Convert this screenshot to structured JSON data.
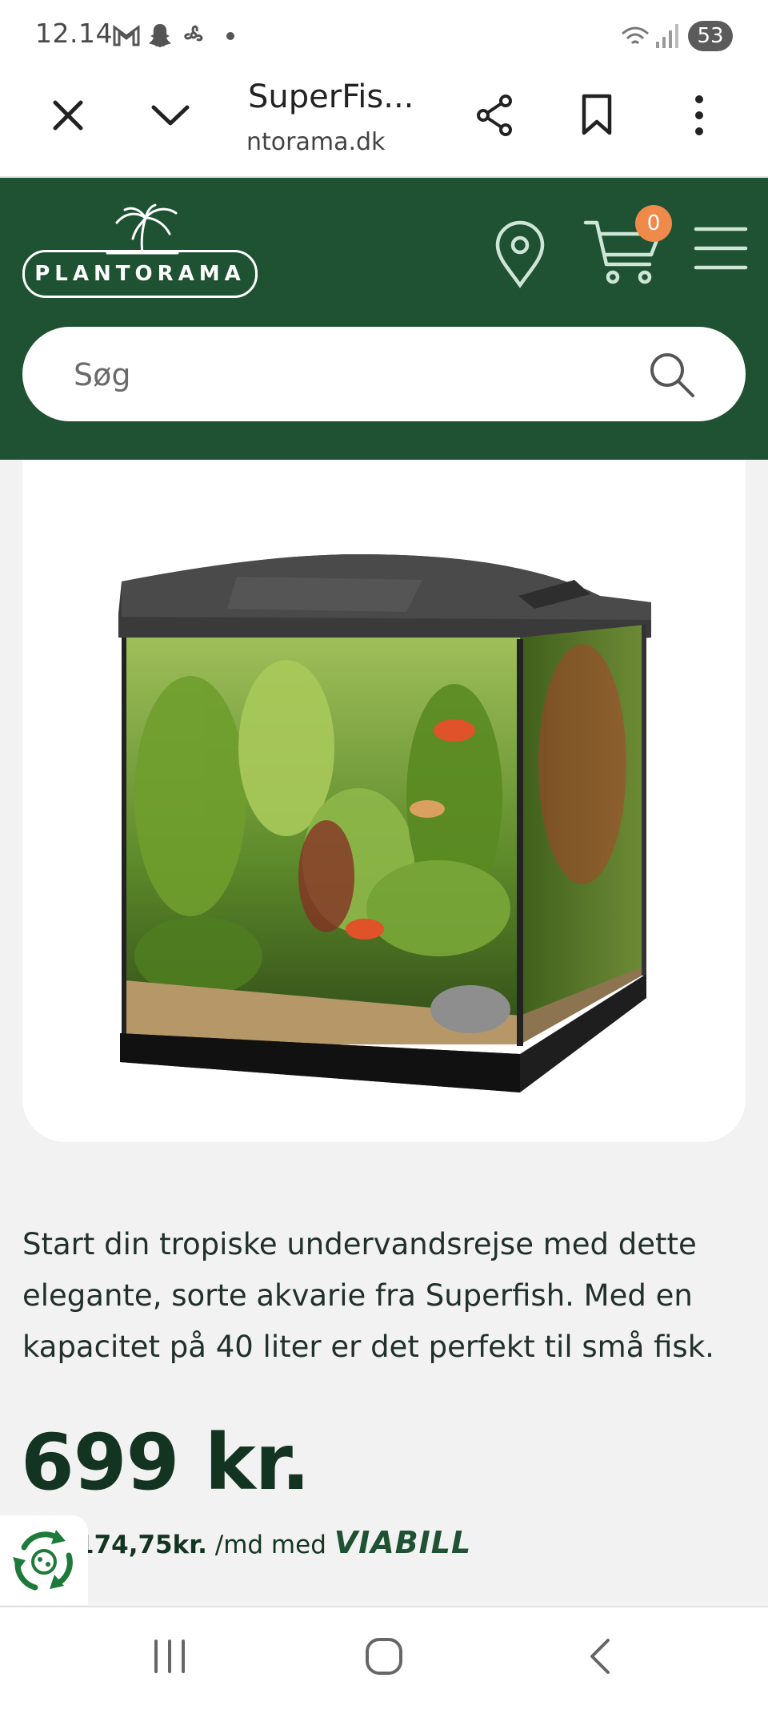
{
  "status_bar": {
    "time": "12.14",
    "battery": "53",
    "icons": [
      "gmail-icon",
      "snapchat-icon",
      "fan-icon",
      "dot-icon",
      "wifi-icon",
      "signal-icon"
    ]
  },
  "browser": {
    "tab_title": "SuperFis...",
    "url": "ntorama.dk",
    "icons": [
      "close-icon",
      "chevron-down-icon",
      "share-icon",
      "bookmark-icon",
      "more-vert-icon"
    ]
  },
  "header": {
    "logo_text": "PLANTORAMA",
    "cart_count": "0",
    "brand_color": "#1e5233",
    "badge_color": "#f08a4b",
    "icons": [
      "location-pin-icon",
      "cart-icon",
      "hamburger-menu-icon"
    ]
  },
  "search": {
    "placeholder": "Søg",
    "icon": "search-icon"
  },
  "product": {
    "image_alt": "aquarium-image",
    "description": "Start din tropiske undervandsrejse med dette elegante, sorte akvarie fra Superfish. Med en kapacitet på 40 liter er det perfekt til små fisk.",
    "price": "699 kr.",
    "installment_amount": "174,75kr.",
    "installment_suffix": " /md med ",
    "provider": "VIABILL"
  },
  "nav": {
    "icons": [
      "recent-apps-icon",
      "home-icon",
      "back-icon"
    ]
  }
}
